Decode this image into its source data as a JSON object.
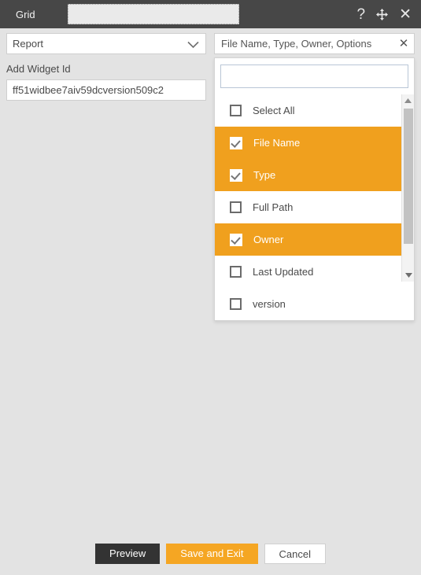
{
  "titlebar": {
    "label": "Grid",
    "search_value": "",
    "search_placeholder": "",
    "help_icon": "question-mark-icon",
    "move_icon": "move-arrows-icon",
    "close_icon": "close-icon"
  },
  "left_panel": {
    "report_select": {
      "selected": "Report",
      "options": [
        "Report"
      ],
      "chevron_icon": "chevron-down-icon"
    },
    "widget_id": {
      "label": "Add Widget Id",
      "value": "ff51widbee7aiv59dcversion509c2",
      "placeholder": ""
    }
  },
  "multiselect": {
    "token_text": "File Name, Type, Owner, Options",
    "clear_icon": "close-icon",
    "search_value": "",
    "search_placeholder": "",
    "select_all": {
      "label": "Select All",
      "checked": false
    },
    "items": [
      {
        "label": "File Name",
        "checked": true
      },
      {
        "label": "Type",
        "checked": true
      },
      {
        "label": "Full Path",
        "checked": false
      },
      {
        "label": "Owner",
        "checked": true
      },
      {
        "label": "Last Updated",
        "checked": false
      },
      {
        "label": "version",
        "checked": false
      }
    ],
    "scrollbar": {
      "up_icon": "caret-up-icon",
      "down_icon": "caret-down-icon"
    }
  },
  "footer": {
    "preview_label": "Preview",
    "save_label": "Save and Exit",
    "cancel_label": "Cancel"
  },
  "colors": {
    "accent_orange": "#f0a01e",
    "button_orange": "#f5a623",
    "header_dark": "#474747",
    "body_gray": "#e3e3e3",
    "button_dark": "#333333"
  }
}
